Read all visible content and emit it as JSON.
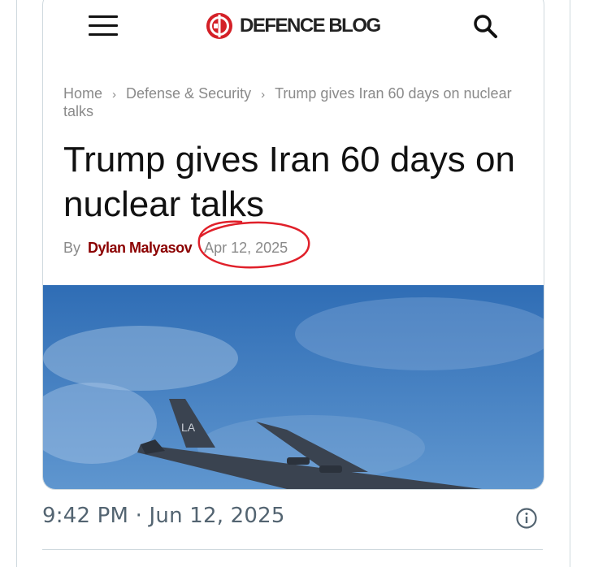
{
  "site": {
    "name": "DEFENCE BLOG",
    "logo_icon": "defence-blog-logo",
    "brand_color": "#d42027"
  },
  "header": {
    "menu_icon": "hamburger-menu-icon",
    "search_icon": "search-icon"
  },
  "breadcrumb": {
    "items": [
      "Home",
      "Defense & Security",
      "Trump gives Iran 60 days on nuclear talks"
    ],
    "separator": "›"
  },
  "article": {
    "title": "Trump gives Iran 60 days on nuclear talks",
    "by_label": "By",
    "author": "Dylan Malyasov",
    "date": "Apr 12, 2025",
    "annotation_color": "#e0202a",
    "image_subject": "B-52 bomber aircraft against blue sky"
  },
  "tweet": {
    "timestamp": "9:42 PM · Jun 12, 2025",
    "info_icon": "info-icon"
  },
  "colors": {
    "author": "#8b0000",
    "muted": "#8a8a8a",
    "sky": "#4f88c6"
  }
}
